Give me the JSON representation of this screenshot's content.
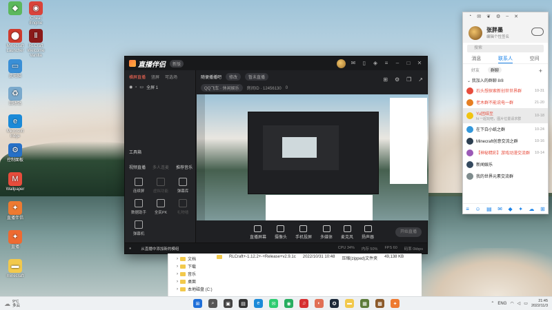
{
  "desktop": {
    "icons": [
      {
        "label": "",
        "color": "#5cb85c",
        "glyph": "◆"
      },
      {
        "label": "Cheat Engine",
        "color": "#d9433a",
        "glyph": "◉"
      },
      {
        "label": "Minecraft Launcher",
        "color": "#cf3b2e",
        "glyph": "⬤"
      },
      {
        "label": "RLCraft Welcome Vanilla",
        "color": "#8b1a1a",
        "glyph": "Ⅱ"
      },
      {
        "label": "此电脑",
        "color": "#3a8fd6",
        "glyph": "▭"
      },
      {
        "label": "回收站",
        "color": "#7aa9cc",
        "glyph": "♻"
      },
      {
        "label": "Microsoft Edge",
        "color": "#1b8ad8",
        "glyph": "e"
      },
      {
        "label": "控制面板",
        "color": "#2670c7",
        "glyph": "⚙"
      },
      {
        "label": "Wallpaper",
        "color": "#e74c3c",
        "glyph": "M"
      },
      {
        "label": "直播伴侣",
        "color": "#ee7a31",
        "glyph": "✦"
      },
      {
        "label": "直播",
        "color": "#ee6a31",
        "glyph": "✦"
      },
      {
        "label": "minecraft",
        "color": "#f2c94c",
        "glyph": "▬"
      }
    ]
  },
  "stream_app": {
    "title": "直播伴侣",
    "version": "新版",
    "left_tabs": [
      "横屏直播",
      "竖屏",
      "可选场"
    ],
    "scene_label": "全屏 1",
    "tools_title": "工具箱",
    "tools_tabs": [
      "视频直播",
      "多人连麦",
      "推荐音乐"
    ],
    "tools": [
      {
        "label": "连续屏",
        "dim": false
      },
      {
        "label": "虚拟功能",
        "dim": true
      },
      {
        "label": "弹幕库",
        "dim": false
      },
      {
        "label": "数据助手",
        "dim": false
      },
      {
        "label": "全民PK",
        "dim": false
      },
      {
        "label": "礼物墙",
        "dim": true
      },
      {
        "label": "弹幕机",
        "dim": false
      }
    ],
    "room_name": "随便播播吧",
    "room_tag": "修改",
    "room_status": "暂未直播",
    "category": "QQ飞车 · 休闲娱乐",
    "room_sub": "房间ID · 12456130",
    "room_likes": "0",
    "bottom_controls": [
      "直播屏幕",
      "摄像头",
      "手机投屏",
      "多媒体",
      "麦克风",
      "扬声器"
    ],
    "start_button": "开始直播",
    "status_notice": "从直播中添加新的模组",
    "status_stats": [
      "CPU 34%",
      "内存 50%",
      "FPS 60",
      "码率 0kbps"
    ]
  },
  "explorer": {
    "nav": [
      "文档",
      "下载",
      "音乐",
      "桌面",
      "本地磁盘 (C:)"
    ],
    "file": {
      "name": "RLCraft+-1.12.2+-+Release+v2.9.1c",
      "date": "2022/10/31 10:48",
      "type": "压缩(zipped)文件夹",
      "size": "49,138 KB"
    }
  },
  "qq": {
    "name": "张胖墨",
    "signature": "编辑个性签名",
    "search_placeholder": "搜索",
    "tabs": [
      "消息",
      "联系人",
      "空间"
    ],
    "active_tab": 1,
    "subtabs": [
      "好友",
      "群聊"
    ],
    "section": "我加入的群聊 8/8",
    "groups": [
      {
        "name": "石头想探索新创世世界群",
        "count": "10-31",
        "color": "#e74c3c",
        "name_color": "#e74c3c"
      },
      {
        "name": "老木群不能说电一群",
        "count": "21-20",
        "color": "#e67e22",
        "name_color": "#e74c3c"
      },
      {
        "name": "Yu团结至",
        "sub": "hi 一起玩吧，图片位置请求群",
        "count": "10-18",
        "color": "#f1c40f",
        "name_color": "#e74c3c",
        "selected": true
      },
      {
        "name": "在下白小纸之群",
        "count": "10-24",
        "color": "#3498db",
        "name_color": "#222"
      },
      {
        "name": "Minecraft创意交流之群",
        "count": "10-16",
        "color": "#2c3e50",
        "name_color": "#222"
      },
      {
        "name": "【神秘精彩】游戏动漫交流群",
        "count": "10-14",
        "color": "#9b59b6",
        "name_color": "#e74c3c"
      },
      {
        "name": "新闻娱乐",
        "count": "",
        "color": "#34495e",
        "name_color": "#222"
      },
      {
        "name": "我的世界元素交流群",
        "count": "",
        "color": "#7f8c8d",
        "name_color": "#222"
      }
    ]
  },
  "taskbar": {
    "weather_temp": "9°C",
    "weather_desc": "多云",
    "apps": [
      {
        "glyph": "⊞",
        "color": "#1e6fd9"
      },
      {
        "glyph": "⌕",
        "color": "#555"
      },
      {
        "glyph": "▣",
        "color": "#444"
      },
      {
        "glyph": "▤",
        "color": "#333"
      },
      {
        "glyph": "e",
        "color": "#1b8ad8"
      },
      {
        "glyph": "✉",
        "color": "#2ecc71"
      },
      {
        "glyph": "◉",
        "color": "#27ae60"
      },
      {
        "glyph": "♫",
        "color": "#d63031"
      },
      {
        "glyph": "◐",
        "color": "#e17055"
      },
      {
        "glyph": "✪",
        "color": "#1b2838"
      },
      {
        "glyph": "▬",
        "color": "#f2c94c"
      },
      {
        "glyph": "▦",
        "color": "#5d7b3a"
      },
      {
        "glyph": "▩",
        "color": "#8b5a2b"
      },
      {
        "glyph": "✦",
        "color": "#ee7a31"
      }
    ],
    "lang": "ENG",
    "time": "21:45",
    "date": "2022/11/3"
  }
}
